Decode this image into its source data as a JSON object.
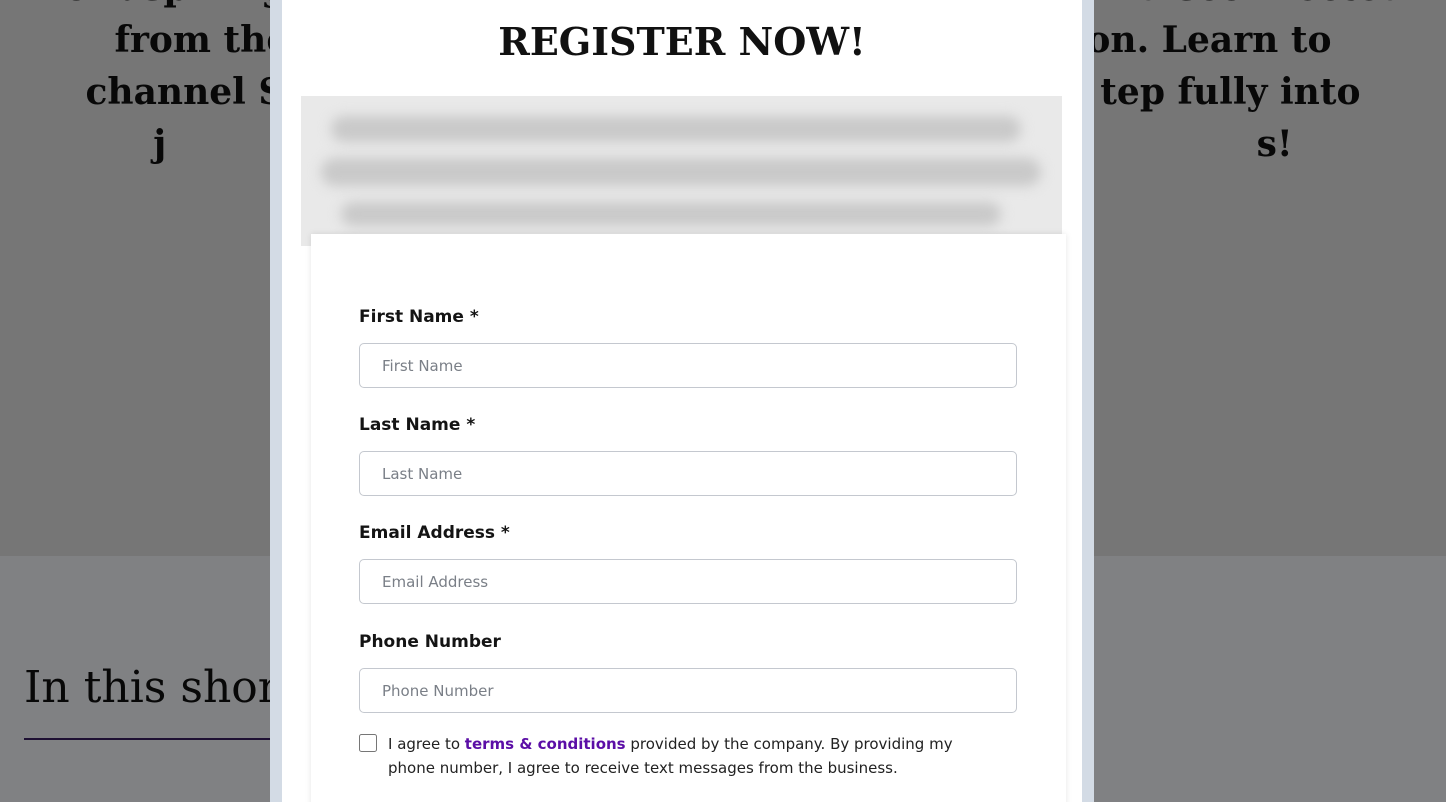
{
  "background": {
    "hero_lines": [
      "For aspiring                                                                    disconnected",
      "from their                                                             on. Learn to",
      "channel Spi                                                              tep fully into",
      "j                                                                                       s!"
    ],
    "section_heading": "In this short",
    "bottom_left_text": "",
    "bottom_right_text": ""
  },
  "modal": {
    "title": "REGISTER NOW!",
    "fields": {
      "first_name": {
        "label": "First Name *",
        "placeholder": "First Name"
      },
      "last_name": {
        "label": "Last Name *",
        "placeholder": "Last Name"
      },
      "email": {
        "label": "Email Address *",
        "placeholder": "Email Address"
      },
      "phone": {
        "label": "Phone Number",
        "placeholder": "Phone Number"
      }
    },
    "terms": {
      "prefix": "I agree to ",
      "link_text": "terms & conditions",
      "suffix": " provided by the company. By providing my phone number, I agree to receive text messages from the business.",
      "checked": false
    }
  },
  "colors": {
    "overlay": "rgba(0,0,0,0.48)",
    "link_purple": "#5b0ea6",
    "divider_purple": "#3a1f63",
    "modal_frame": "#d3dbe5"
  }
}
